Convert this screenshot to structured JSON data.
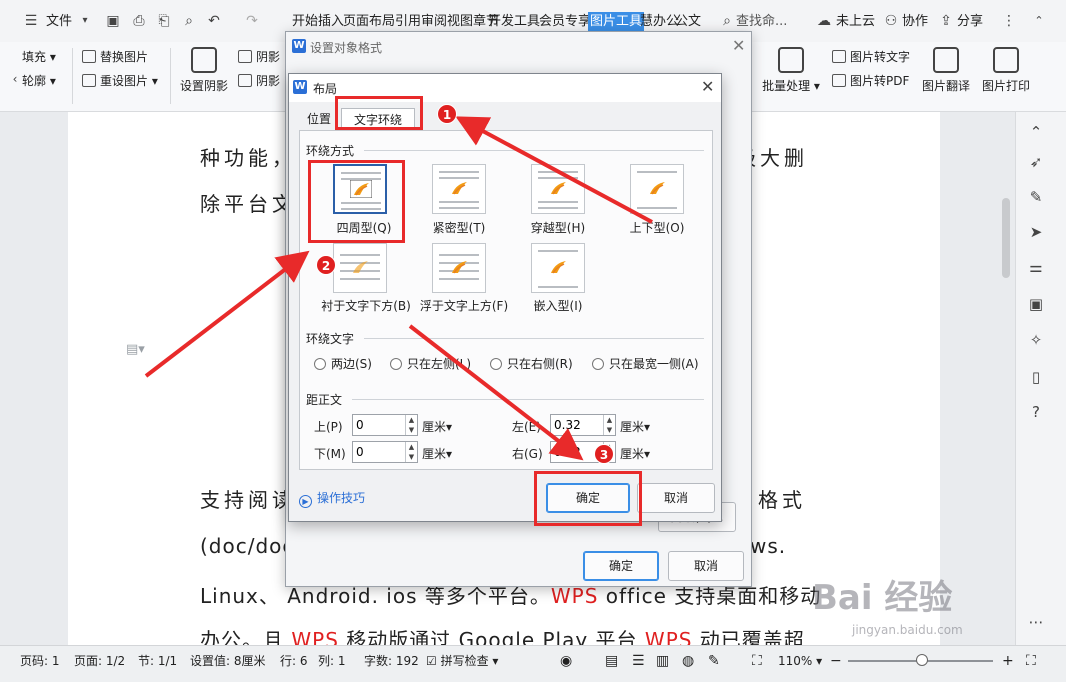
{
  "menubar": {
    "file_label": "文件",
    "tabs": [
      "开始",
      "插入",
      "页面布局",
      "引用",
      "审阅",
      "视图",
      "章节",
      "开发工具",
      "会员专享",
      "图片工具",
      "慧办公",
      "公文"
    ],
    "active_tab": "图片工具",
    "search_label": "查找命...",
    "cloud_label": "未上云",
    "collab_label": "协作",
    "share_label": "分享"
  },
  "ribbon": {
    "fill_label": "填充",
    "outline_label": "轮廓",
    "replace_image": "替换图片",
    "reset_image": "重设图片",
    "shadow_settings": "设置阴影",
    "shadow1": "阴影",
    "shadow2": "阴影",
    "batch_process": "批量处理",
    "image_to_text": "图片转文字",
    "image_to_pdf": "图片转PDF",
    "image_translate": "图片翻译",
    "image_print": "图片打印"
  },
  "document": {
    "line1": "种功能，",
    "line1_right": "极大删",
    "line2": "除平台文",
    "line3_a": "支持阅读",
    "line3_b": "格式",
    "line4_a": "(doc/doc",
    "line4_b": "ws.",
    "line5_a": "Linux、 Android. ios 等多个平台。",
    "line5_wps": "WPS",
    "line5_b": " office 支持桌面和移动",
    "line6_a": "办公。且 ",
    "line6_wps1": "WPS",
    "line6_b": " 移动版通过 Google Play 平台 ",
    "line6_wps2": "WPS",
    "line6_c": " 动已覆盖超"
  },
  "dialog_back": {
    "title": "设置对象格式",
    "ok_label": "确定",
    "cancel_label": "取消",
    "hidden_button_label": "高级(A)..."
  },
  "dialog_front": {
    "title": "布局",
    "tabs": [
      "位置",
      "文字环绕"
    ],
    "active_tab": "文字环绕",
    "wrap_style_group": "环绕方式",
    "wrap_styles": [
      "四周型(Q)",
      "紧密型(T)",
      "穿越型(H)",
      "上下型(O)",
      "衬于文字下方(B)",
      "浮于文字上方(F)",
      "嵌入型(I)"
    ],
    "selected_wrap_style": "四周型(Q)",
    "wrap_text_group": "环绕文字",
    "wrap_text_options": [
      "两边(S)",
      "只在左侧(L)",
      "只在右侧(R)",
      "只在最宽一侧(A)"
    ],
    "distance_group": "距正文",
    "top_label": "上(P)",
    "top_value": "0",
    "bottom_label": "下(M)",
    "bottom_value": "0",
    "left_label": "左(E)",
    "left_value": "0.32",
    "right_label": "右(G)",
    "right_value": "0.32",
    "unit_label": "厘米",
    "tips_label": "操作技巧",
    "ok_label": "确定",
    "cancel_label": "取消"
  },
  "annotations": [
    "1",
    "2",
    "3"
  ],
  "statusbar": {
    "page_code": "页码: 1",
    "pages": "页面: 1/2",
    "section": "节: 1/1",
    "setting": "设置值: 8厘米",
    "row": "行: 6",
    "col": "列: 1",
    "words": "字数: 192",
    "spellcheck": "拼写检查",
    "zoom": "110%"
  },
  "watermark": {
    "brand": "Bai  经验",
    "url": "jingyan.baidu.com"
  },
  "colors": {
    "accent": "#3a8ee6",
    "annotation_red": "#e02020",
    "wps_red": "#e02020",
    "selected_border": "#2b5fa8"
  }
}
